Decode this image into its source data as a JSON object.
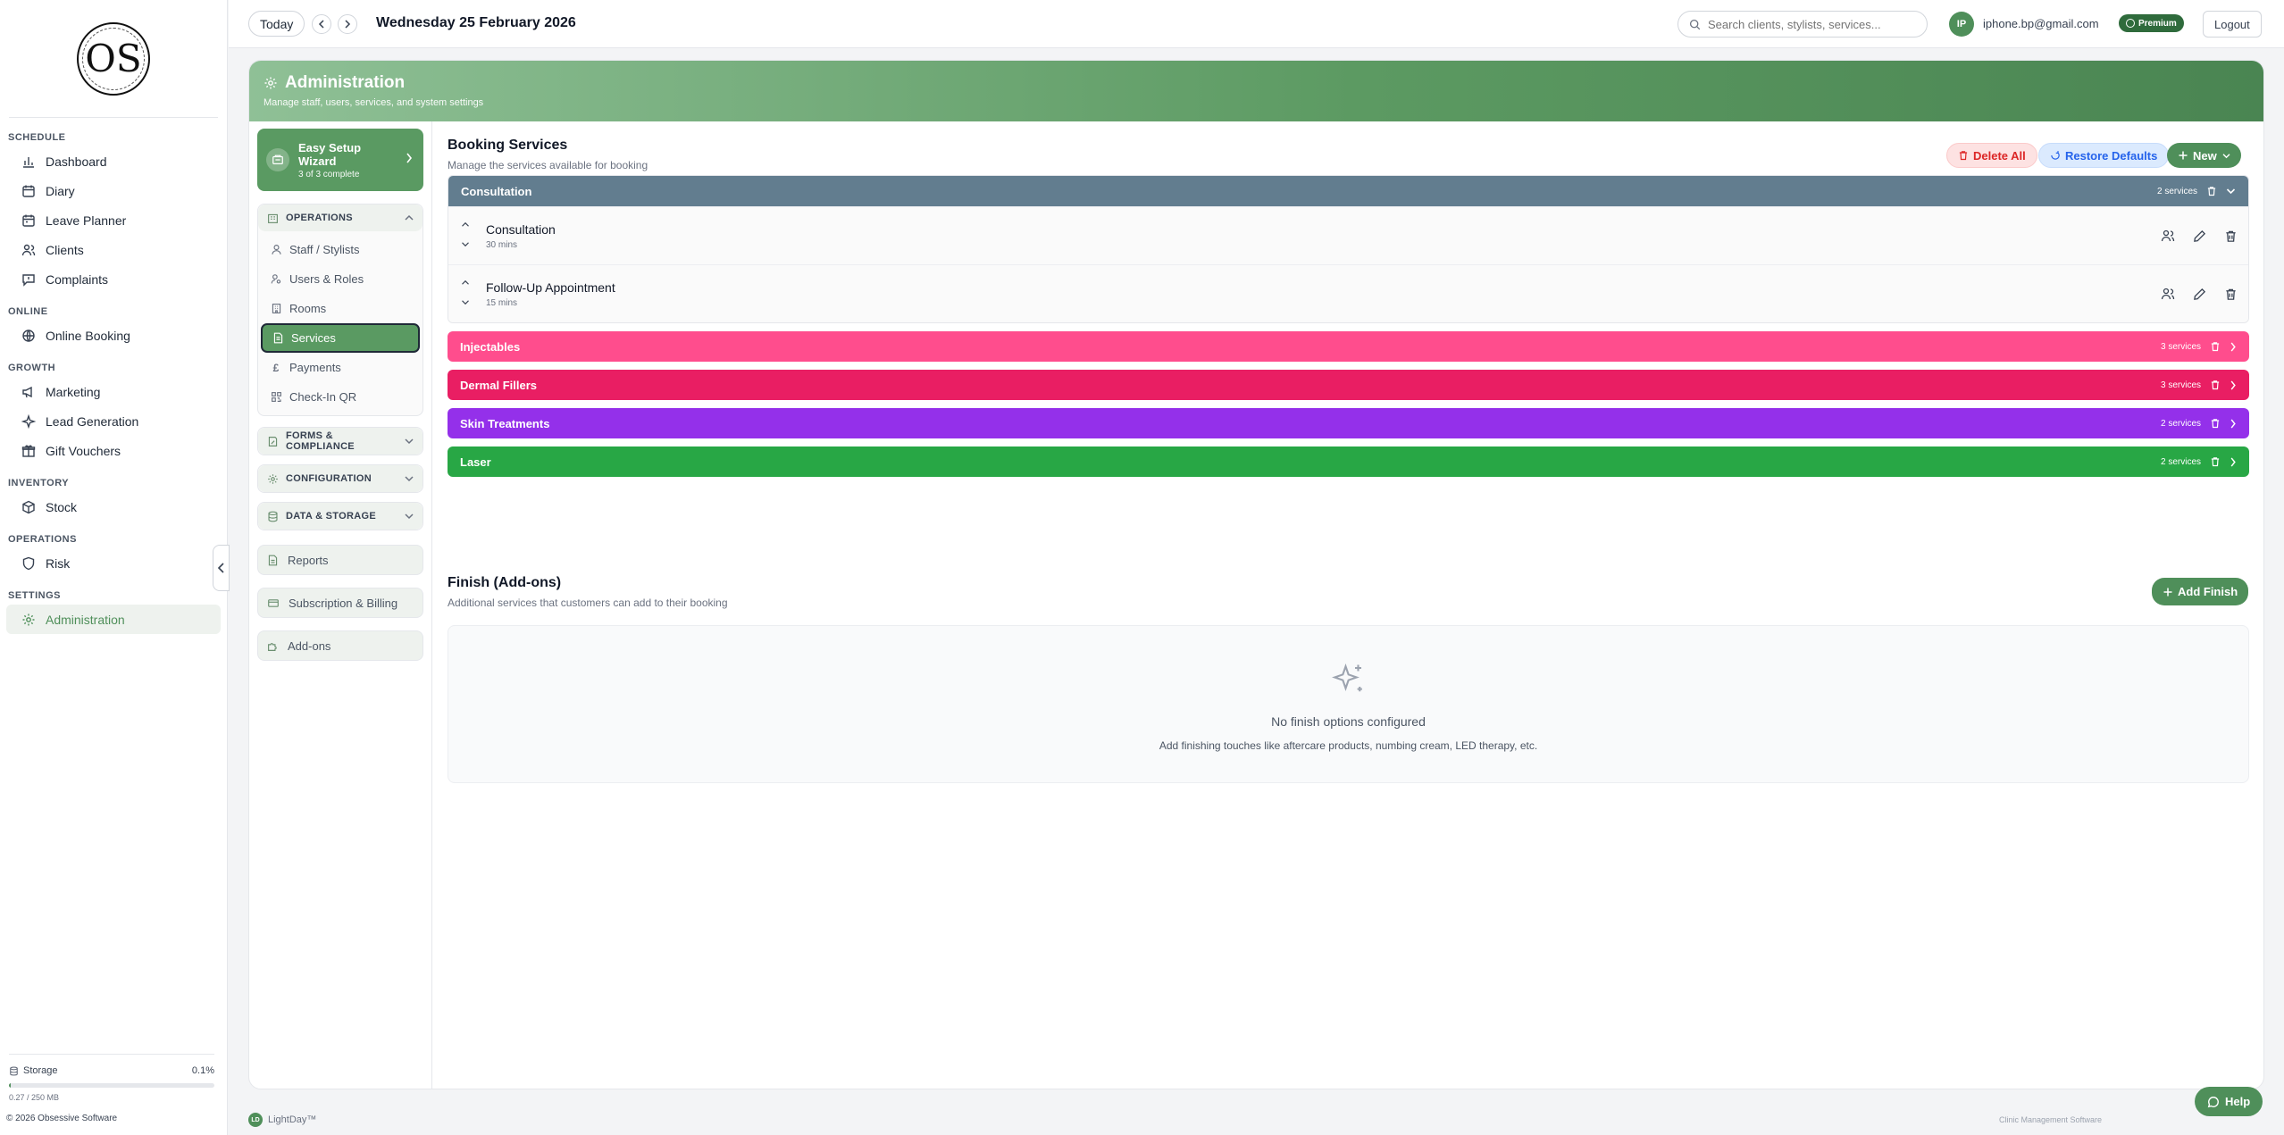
{
  "colors": {
    "brand": "#4f8f5a",
    "consultation": "#627d8f",
    "injectables": "#ff4d8d",
    "dermal_fillers": "#e91e63",
    "skin_treatments": "#9430ea",
    "laser": "#28a745"
  },
  "logo": {
    "text": "OS"
  },
  "nav": {
    "sections": [
      {
        "title": "SCHEDULE",
        "items": [
          {
            "label": "Dashboard",
            "icon": "chart-icon"
          },
          {
            "label": "Diary",
            "icon": "calendar-icon"
          },
          {
            "label": "Leave Planner",
            "icon": "calendar-icon"
          },
          {
            "label": "Clients",
            "icon": "users-icon"
          },
          {
            "label": "Complaints",
            "icon": "message-icon"
          }
        ]
      },
      {
        "title": "ONLINE",
        "items": [
          {
            "label": "Online Booking",
            "icon": "globe-icon"
          }
        ]
      },
      {
        "title": "GROWTH",
        "items": [
          {
            "label": "Marketing",
            "icon": "megaphone-icon"
          },
          {
            "label": "Lead Generation",
            "icon": "sparkle-icon"
          },
          {
            "label": "Gift Vouchers",
            "icon": "gift-icon"
          }
        ]
      },
      {
        "title": "INVENTORY",
        "items": [
          {
            "label": "Stock",
            "icon": "box-icon"
          }
        ]
      },
      {
        "title": "OPERATIONS",
        "items": [
          {
            "label": "Risk",
            "icon": "shield-icon"
          }
        ]
      },
      {
        "title": "SETTINGS",
        "items": [
          {
            "label": "Administration",
            "icon": "gear-icon",
            "active": true
          }
        ]
      }
    ],
    "storage": {
      "label": "Storage",
      "percent_text": "0.1%",
      "fraction": 0.001,
      "detail": "0.27 / 250 MB"
    },
    "copyright": "© 2026 Obsessive Software"
  },
  "topbar": {
    "today_label": "Today",
    "date": "Wednesday 25 February 2026",
    "search_placeholder": "Search clients, stylists, services...",
    "user_initials": "IP",
    "user_email": "iphone.bp@gmail.com",
    "plan": "Premium",
    "logout_label": "Logout"
  },
  "banner": {
    "title": "Administration",
    "subtitle": "Manage staff, users, services, and system settings"
  },
  "subnav": {
    "wizard": {
      "title": "Easy Setup Wizard",
      "progress": "3 of 3 complete"
    },
    "operations": {
      "title": "OPERATIONS",
      "items": [
        {
          "label": "Staff / Stylists"
        },
        {
          "label": "Users & Roles"
        },
        {
          "label": "Rooms"
        },
        {
          "label": "Services",
          "active": true
        },
        {
          "label": "Payments"
        },
        {
          "label": "Check-In QR"
        }
      ]
    },
    "forms_title": "FORMS & COMPLIANCE",
    "config_title": "CONFIGURATION",
    "data_title": "DATA & STORAGE",
    "reports": "Reports",
    "billing": "Subscription & Billing",
    "addons": "Add-ons"
  },
  "booking": {
    "title": "Booking Services",
    "subtitle": "Manage the services available for booking",
    "delete_all": "Delete All",
    "restore": "Restore Defaults",
    "new": "New",
    "categories": [
      {
        "name": "Consultation",
        "count": "2 services",
        "expanded": true,
        "services": [
          {
            "name": "Consultation",
            "duration": "30 mins"
          },
          {
            "name": "Follow-Up Appointment",
            "duration": "15 mins"
          }
        ]
      },
      {
        "name": "Injectables",
        "count": "3 services"
      },
      {
        "name": "Dermal Fillers",
        "count": "3 services"
      },
      {
        "name": "Skin Treatments",
        "count": "2 services"
      },
      {
        "name": "Laser",
        "count": "2 services"
      }
    ]
  },
  "finish": {
    "title": "Finish (Add-ons)",
    "subtitle": "Additional services that customers can add to their booking",
    "add_label": "Add Finish",
    "empty_title": "No finish options configured",
    "empty_sub": "Add finishing touches like aftercare products, numbing cream, LED therapy, etc."
  },
  "footer": {
    "badge": "LD",
    "brand": "LightDay™",
    "right": "Clinic Management Software",
    "help": "Help"
  }
}
